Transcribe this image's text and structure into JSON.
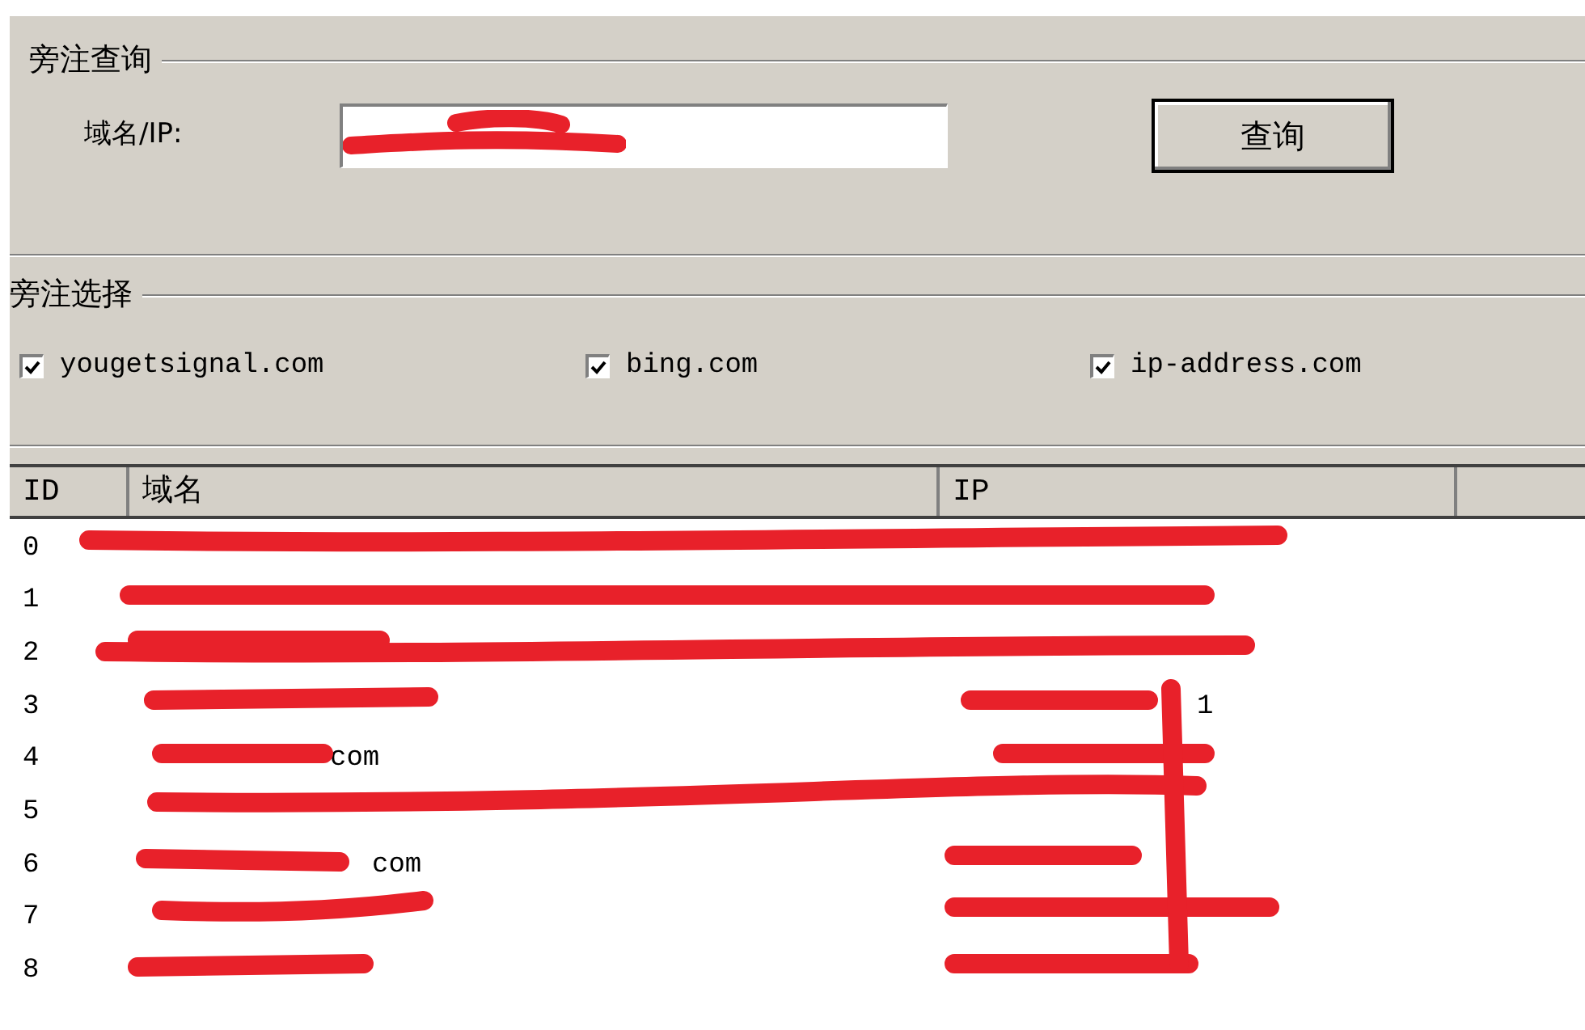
{
  "query_group": {
    "title": "旁注查询",
    "field_label": "域名/IP:",
    "button": "查询"
  },
  "source_group": {
    "title": "旁注选择",
    "sources": [
      {
        "label": "yougetsignal.com",
        "checked": true
      },
      {
        "label": "bing.com",
        "checked": true
      },
      {
        "label": "ip-address.com",
        "checked": true
      }
    ]
  },
  "table": {
    "columns": [
      "ID",
      "域名",
      "IP"
    ],
    "rows": [
      {
        "id": "0"
      },
      {
        "id": "1"
      },
      {
        "id": "2"
      },
      {
        "id": "3",
        "ip": "1"
      },
      {
        "id": "4",
        "domain": "com"
      },
      {
        "id": "5"
      },
      {
        "id": "6",
        "domain": "com"
      },
      {
        "id": "7"
      },
      {
        "id": "8"
      }
    ]
  }
}
